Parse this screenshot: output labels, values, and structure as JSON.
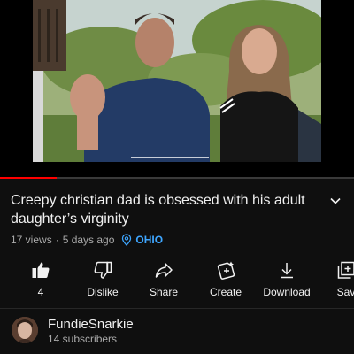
{
  "video": {
    "title": "Creepy christian dad is obsessed with his adult daughter’s virginity",
    "views": "17 views",
    "age": "5 days ago",
    "location": "OHIO",
    "progress": 0.16
  },
  "actions": [
    {
      "id": "like",
      "label": "4",
      "icon": "thumbs-up-icon"
    },
    {
      "id": "dislike",
      "label": "Dislike",
      "icon": "thumbs-down-icon"
    },
    {
      "id": "share",
      "label": "Share",
      "icon": "share-icon"
    },
    {
      "id": "create",
      "label": "Create",
      "icon": "create-icon"
    },
    {
      "id": "download",
      "label": "Download",
      "icon": "download-icon"
    },
    {
      "id": "save",
      "label": "Sav",
      "icon": "save-to-playlist-icon"
    }
  ],
  "channel": {
    "name": "FundieSnarkie",
    "subscribers": "14 subscribers"
  },
  "colors": {
    "background": "#0f0f0f",
    "text": "#f1f1f1",
    "secondary_text": "#aaaaaa",
    "link": "#3ea6ff",
    "progress": "#ff0000"
  }
}
